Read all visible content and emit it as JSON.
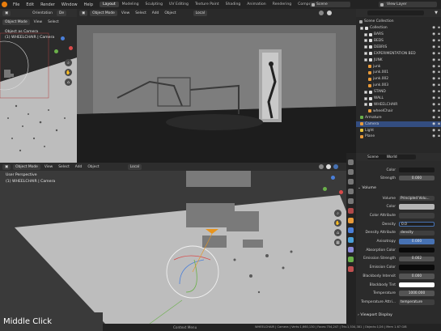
{
  "menu": [
    "File",
    "Edit",
    "Render",
    "Window",
    "Help"
  ],
  "workspace_tabs": [
    {
      "label": "Layout",
      "active": true
    },
    {
      "label": "Modeling",
      "active": false
    },
    {
      "label": "Sculpting",
      "active": false
    },
    {
      "label": "UV Editing",
      "active": false
    },
    {
      "label": "Texture Paint",
      "active": false
    },
    {
      "label": "Shading",
      "active": false
    },
    {
      "label": "Animation",
      "active": false
    },
    {
      "label": "Rendering",
      "active": false
    },
    {
      "label": "Compositing",
      "active": false
    }
  ],
  "scene_field": "Scene",
  "view_layer_field": "View Layer",
  "camera_view": {
    "mode": "Object Mode",
    "items": [
      "View",
      "Select",
      "Add",
      "Object"
    ],
    "transform": "Local",
    "overlay_1": "Object as Camera",
    "overlay_2": "(1) WHEELCHAIR | Camera",
    "orientation_label": "Orientation",
    "orientation_value": "De"
  },
  "render_view": {
    "mode": "Object Mode",
    "items": [
      "View",
      "Select",
      "Add",
      "Object"
    ],
    "transform": "Local"
  },
  "main_view": {
    "mode": "Object Mode",
    "items": [
      "View",
      "Select",
      "Add",
      "Object"
    ],
    "transform": "Local",
    "overlay_1": "User Perspective",
    "overlay_2": "(1) WHEELCHAIR | Camera"
  },
  "outliner": {
    "title": "Scene Collection",
    "rows": [
      {
        "label": "Collection",
        "indent": 1,
        "type": "collection",
        "selected": false
      },
      {
        "label": "BARS",
        "indent": 2,
        "type": "collection",
        "selected": false
      },
      {
        "label": "BEDS",
        "indent": 2,
        "type": "collection",
        "selected": false
      },
      {
        "label": "DEBRIS",
        "indent": 2,
        "type": "collection",
        "selected": false
      },
      {
        "label": "EXPERIMENTATION BED",
        "indent": 2,
        "type": "collection",
        "selected": false
      },
      {
        "label": "JUNK",
        "indent": 2,
        "type": "collection",
        "selected": false
      },
      {
        "label": "junk",
        "indent": 3,
        "type": "object",
        "selected": false
      },
      {
        "label": "junk.001",
        "indent": 3,
        "type": "object",
        "selected": false
      },
      {
        "label": "junk.002",
        "indent": 3,
        "type": "object",
        "selected": false
      },
      {
        "label": "junk.003",
        "indent": 3,
        "type": "object",
        "selected": false
      },
      {
        "label": "STAND",
        "indent": 2,
        "type": "collection",
        "selected": false
      },
      {
        "label": "WALL",
        "indent": 2,
        "type": "collection",
        "selected": false
      },
      {
        "label": "WHEELCHAIR",
        "indent": 2,
        "type": "collection",
        "selected": false
      },
      {
        "label": "wheelChair",
        "indent": 3,
        "type": "object",
        "selected": false
      },
      {
        "label": "Armature",
        "indent": 1,
        "type": "armature",
        "selected": false
      },
      {
        "label": "Camera",
        "indent": 1,
        "type": "camera",
        "selected": true
      },
      {
        "label": "Light",
        "indent": 1,
        "type": "light",
        "selected": false
      },
      {
        "label": "Plane",
        "indent": 1,
        "type": "object",
        "selected": false
      }
    ]
  },
  "properties": {
    "breadcrumb_scene": "Scene",
    "breadcrumb_world": "World",
    "rows": [
      {
        "label": "Color",
        "value": "",
        "kind": "color-dark"
      },
      {
        "label": "Strength",
        "value": "0.000",
        "kind": "number"
      }
    ],
    "volume_header": "Volume",
    "volume_rows": [
      {
        "label": "Volume",
        "value": "Principled Volu...",
        "kind": "dropdown"
      },
      {
        "label": "Color",
        "value": "",
        "kind": "color-light"
      },
      {
        "label": "Color Attribute",
        "value": "",
        "kind": "text"
      },
      {
        "label": "Density",
        "value": "0.0",
        "kind": "editing"
      },
      {
        "label": "Density Attribute",
        "value": "density",
        "kind": "text"
      },
      {
        "label": "Anisotropy",
        "value": "0.000",
        "kind": "number-blue"
      },
      {
        "label": "Absorption Color",
        "value": "",
        "kind": "color-black"
      },
      {
        "label": "Emission Strength",
        "value": "0.002",
        "kind": "number"
      },
      {
        "label": "Emission Color",
        "value": "",
        "kind": "color-black"
      },
      {
        "label": "Blackbody Intensit",
        "value": "0.000",
        "kind": "number"
      },
      {
        "label": "Blackbody Tint",
        "value": "",
        "kind": "color-white"
      },
      {
        "label": "Temperature",
        "value": "1000.000",
        "kind": "number"
      },
      {
        "label": "Temperature Attri...",
        "value": "temperature",
        "kind": "text"
      }
    ],
    "viewport_display": "Viewport Display"
  },
  "statusbar": {
    "context_menu": "Context Menu",
    "stats": "WHEELCHAIR | Camera | Verts:1,660,130 | Faces:754,247 | Tris:1,534,381 | Objects:1/26 | Mem 1.67 GiB"
  },
  "overlay_hint": "Middle Click",
  "colors": {
    "accent": "#4772b3",
    "selected_row": "#334d80",
    "camera_orange": "#e8941c"
  }
}
